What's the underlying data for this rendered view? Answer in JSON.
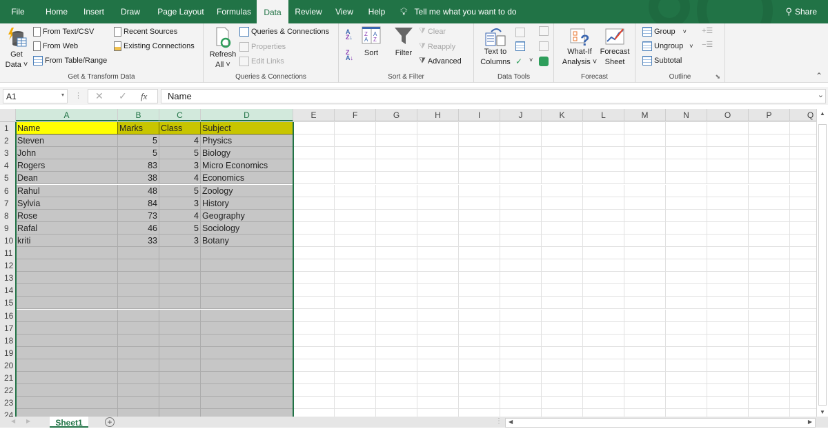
{
  "menu": {
    "tabs": [
      {
        "label": "File"
      },
      {
        "label": "Home"
      },
      {
        "label": "Insert"
      },
      {
        "label": "Draw"
      },
      {
        "label": "Page Layout"
      },
      {
        "label": "Formulas"
      },
      {
        "label": "Data"
      },
      {
        "label": "Review"
      },
      {
        "label": "View"
      },
      {
        "label": "Help"
      }
    ],
    "active_tab": "Data",
    "tell_me": "Tell me what you want to do",
    "share": "Share",
    "accent_color": "#217346"
  },
  "ribbon": {
    "get_transform": {
      "group_label": "Get & Transform Data",
      "get_data": "Get",
      "get_data_2": "Data",
      "from_text_csv": "From Text/CSV",
      "from_web": "From Web",
      "from_table_range": "From Table/Range",
      "recent_sources": "Recent Sources",
      "existing_connections": "Existing Connections"
    },
    "queries": {
      "group_label": "Queries & Connections",
      "refresh_1": "Refresh",
      "refresh_2": "All",
      "queries_connections": "Queries & Connections",
      "properties": "Properties",
      "edit_links": "Edit Links"
    },
    "sort_filter": {
      "group_label": "Sort & Filter",
      "sort_az": "A↓Z",
      "sort_za": "Z↓A",
      "sort": "Sort",
      "filter": "Filter",
      "clear": "Clear",
      "reapply": "Reapply",
      "advanced": "Advanced"
    },
    "data_tools": {
      "group_label": "Data Tools",
      "text_to_1": "Text to",
      "text_to_2": "Columns"
    },
    "forecast": {
      "group_label": "Forecast",
      "whatif_1": "What-If",
      "whatif_2": "Analysis",
      "forecast_1": "Forecast",
      "forecast_2": "Sheet"
    },
    "outline": {
      "group_label": "Outline",
      "group": "Group",
      "ungroup": "Ungroup",
      "subtotal": "Subtotal"
    }
  },
  "formula_bar": {
    "name_box": "A1",
    "fx": "fx",
    "cancel": "✕",
    "enter": "✓",
    "value": "Name"
  },
  "grid": {
    "columns": [
      "A",
      "B",
      "C",
      "D",
      "E",
      "F",
      "G",
      "H",
      "I",
      "J",
      "K",
      "L",
      "M",
      "N",
      "O",
      "P",
      "Q"
    ],
    "rows": [
      "1",
      "2",
      "3",
      "4",
      "5",
      "6",
      "7",
      "8",
      "9",
      "10",
      "11",
      "12",
      "13",
      "14",
      "15",
      "16",
      "17",
      "18",
      "19",
      "20",
      "21",
      "22",
      "23",
      "24"
    ],
    "header_row": [
      "Name",
      "Marks",
      "Class",
      "Subject"
    ],
    "data": [
      [
        "Steven",
        "5",
        "4",
        "Physics"
      ],
      [
        "John",
        "5",
        "5",
        "Biology"
      ],
      [
        "Rogers",
        "83",
        "3",
        "Micro Economics"
      ],
      [
        "Dean",
        "38",
        "4",
        "Economics"
      ],
      [
        "Rahul",
        "48",
        "5",
        "Zoology"
      ],
      [
        "Sylvia",
        "84",
        "3",
        "History"
      ],
      [
        "Rose",
        "73",
        "4",
        "Geography"
      ],
      [
        "Rafal",
        "46",
        "5",
        "Sociology"
      ],
      [
        "kriti",
        "33",
        "3",
        "Botany"
      ]
    ],
    "selected_columns": [
      "A",
      "B",
      "C",
      "D"
    ],
    "highlight_colors": {
      "a1": "#ffff00",
      "header": "#c8c500",
      "selection": "#c6c6c6"
    }
  },
  "sheets": {
    "tabs": [
      {
        "label": "Sheet1"
      }
    ],
    "add_sheet": "+"
  }
}
